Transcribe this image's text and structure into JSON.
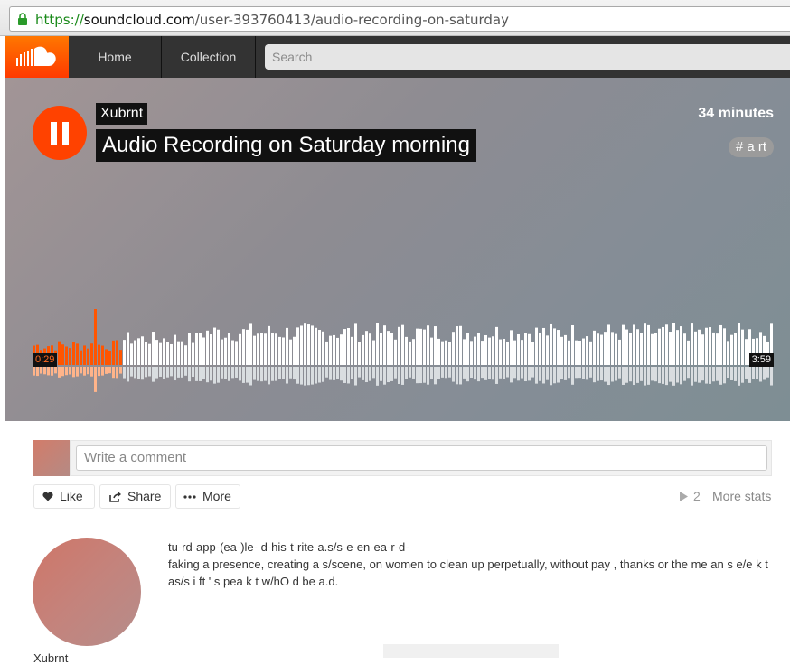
{
  "browser": {
    "url_scheme": "https://",
    "url_host": "soundcloud.com",
    "url_path": "/user-393760413/audio-recording-on-saturday"
  },
  "header": {
    "nav": [
      {
        "label": "Home"
      },
      {
        "label": "Collection"
      }
    ],
    "search_placeholder": "Search",
    "logo_icon": "soundcloud-logo-icon"
  },
  "track": {
    "artist": "Xubrnt",
    "title": "Audio Recording on Saturday morning",
    "duration_label": "34 minutes",
    "tag": "# a rt",
    "current_time": "0:29",
    "total_time": "3:59",
    "progress": 0.12,
    "accent_color": "#ff5500"
  },
  "comment": {
    "placeholder": "Write a comment"
  },
  "actions": {
    "like": "Like",
    "share": "Share",
    "more": "More",
    "plays": "2",
    "more_stats": "More stats"
  },
  "description": {
    "line1": "tu-rd-app-(ea-)le- d-his-t-rite-a.s/s-e-en-ea-r-d-",
    "line2": "faking a presence, creating a s/scene, on women to clean up perpetually, without pay , thanks or the me an s e/e k t as/s i ft ' s pea k t w/hO d be a.d."
  },
  "uploader": {
    "name": "Xubrnt"
  }
}
